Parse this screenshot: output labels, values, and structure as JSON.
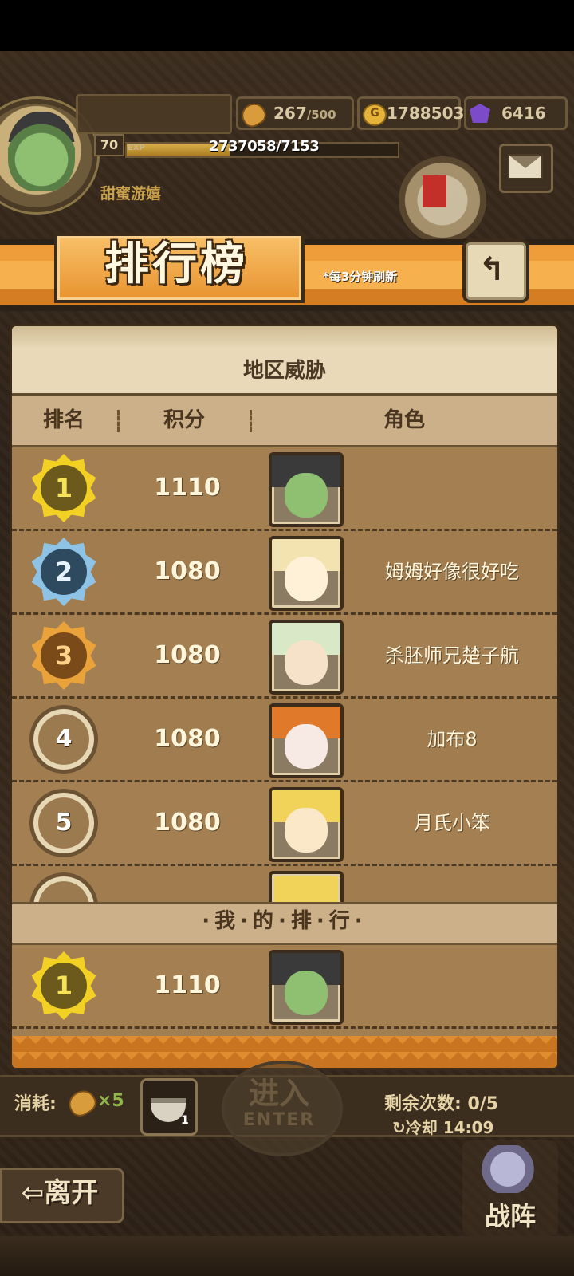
{
  "player": {
    "level": "70",
    "exp_tag": "EXP",
    "exp_text": "2737058/7153",
    "exp_fraction": 0.38,
    "name": "甜蜜游嬉"
  },
  "resources": {
    "stamina_value": "267",
    "stamina_max": "/500",
    "gold_icon_glyph": "G",
    "gold": "1788503",
    "gems": "6416"
  },
  "banner": {
    "title": "排行榜",
    "note": "*每3分钟刷新",
    "back_glyph": "↰"
  },
  "panel": {
    "title": "地区威胁",
    "columns": [
      "排名",
      "积分",
      "角色"
    ]
  },
  "ranking": [
    {
      "rank": "1",
      "score": "1110",
      "name": "",
      "style": "gold",
      "hair": "#3a3a3a",
      "skin": "#8fbf71"
    },
    {
      "rank": "2",
      "score": "1080",
      "name": "姆姆好像很好吃",
      "style": "silver",
      "hair": "#f3e3b0",
      "skin": "#fff1d8"
    },
    {
      "rank": "3",
      "score": "1080",
      "name": "杀胚师兄楚子航",
      "style": "bronze",
      "hair": "#d9e8c6",
      "skin": "#f6e2c8"
    },
    {
      "rank": "4",
      "score": "1080",
      "name": "加布8",
      "style": "plain",
      "hair": "#e07a2a",
      "skin": "#f7e9e4"
    },
    {
      "rank": "5",
      "score": "1080",
      "name": "月氏小笨",
      "style": "plain",
      "hair": "#f1d35a",
      "skin": "#fbe8c8"
    }
  ],
  "my_rank": {
    "label": "·我·的·排·行·",
    "rank": "1",
    "score": "1110",
    "name": ""
  },
  "footer": {
    "consume_label": "消耗:",
    "consume_count": "×5",
    "item_count": "1",
    "enter_text": "进入",
    "enter_sub": "ENTER",
    "remaining": "剩余次数: 0/5",
    "cooldown": "↻冷却 14:09",
    "leave": "⇦离开",
    "formation": "战阵"
  },
  "colors": {
    "gold_badge": "#f2d024",
    "silver_badge": "#8fc3e6",
    "bronze_badge": "#e9a33a",
    "accent_orange": "#ef9c3a"
  }
}
